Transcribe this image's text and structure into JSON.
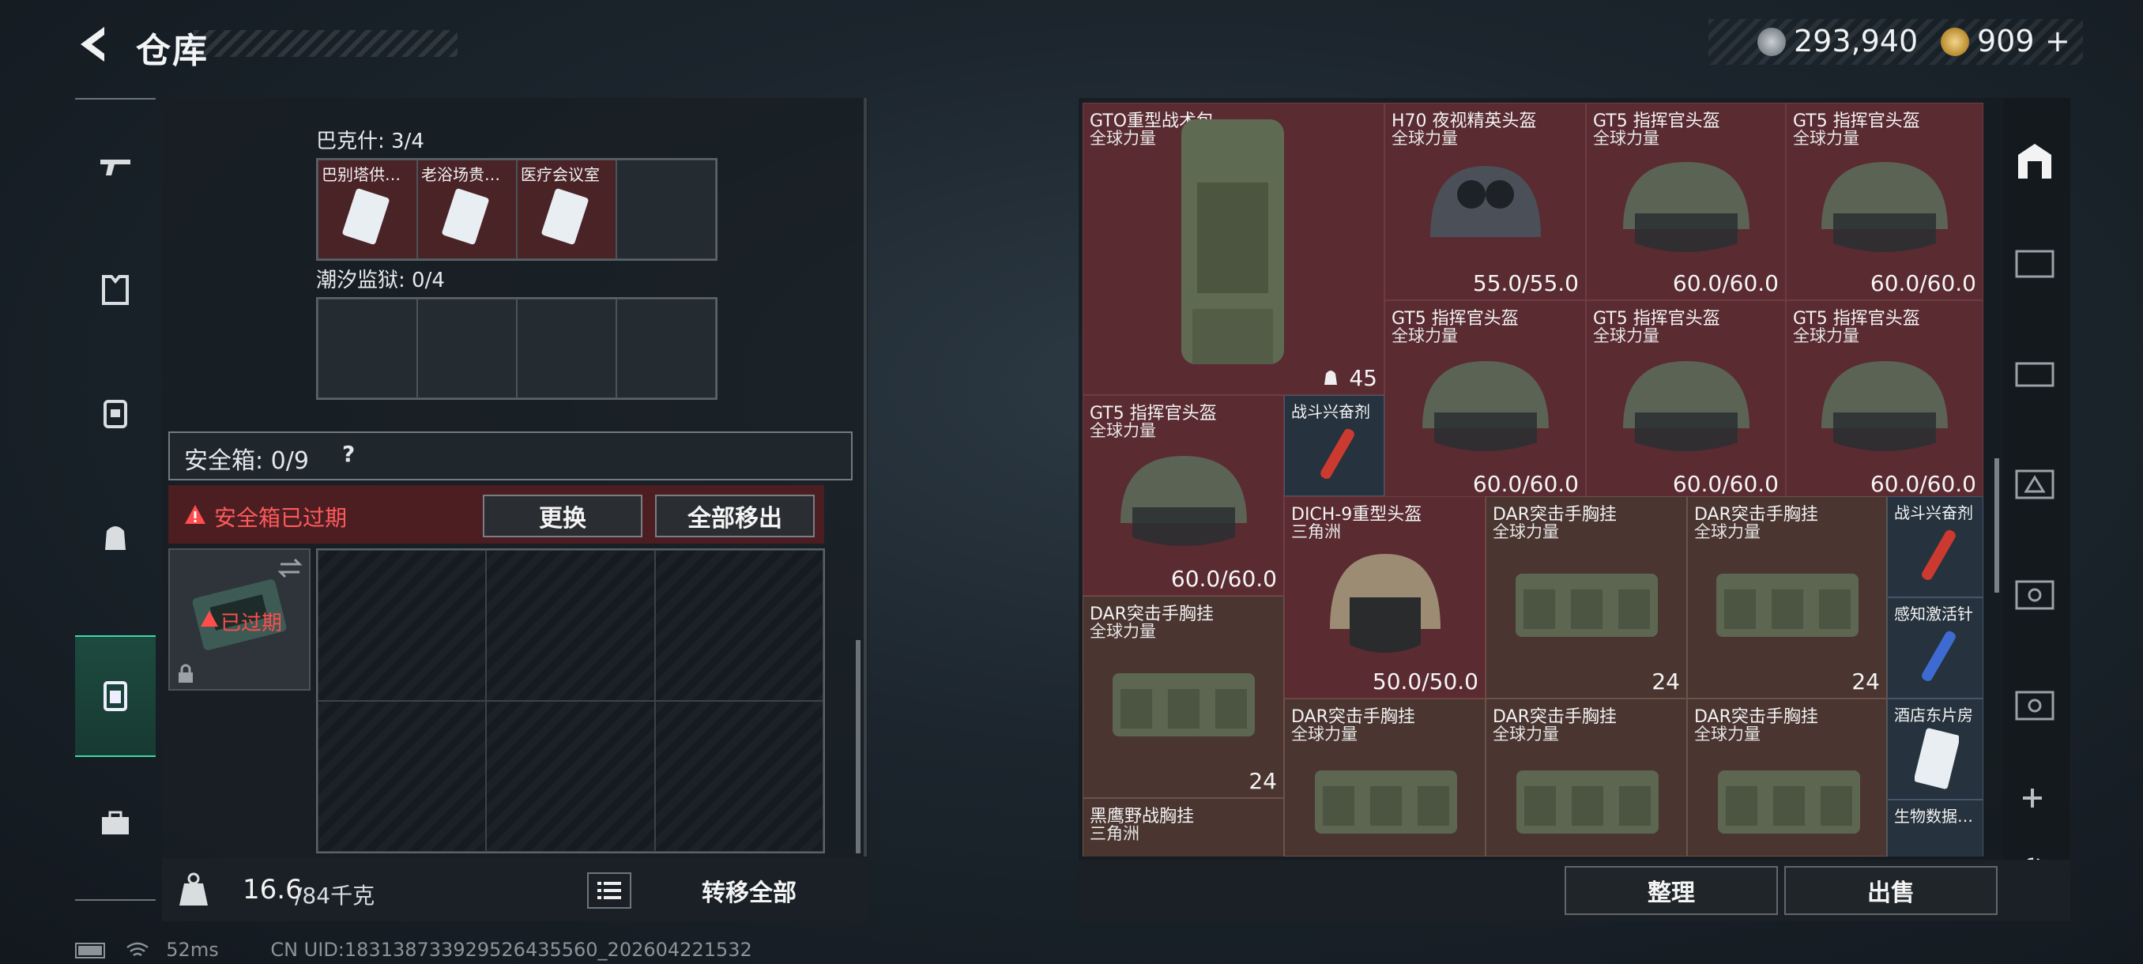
{
  "header": {
    "title": "仓库",
    "currency_1": "293,940",
    "currency_2": "909",
    "plus": "+"
  },
  "left_nav": [
    "weapon-icon",
    "armor-icon",
    "backpack-icon",
    "bag-icon",
    "safebox-icon",
    "case-icon"
  ],
  "left_panel": {
    "group_1_label": "巴克什: 3/4",
    "group_1_items": [
      "巴别塔供…",
      "老浴场贵…",
      "医疗会议室"
    ],
    "group_2_label": "潮汐监狱: 0/4",
    "safebox_label": "安全箱: 0/9",
    "safebox_help": "?",
    "expired_warning": "安全箱已过期",
    "replace_button": "更换",
    "remove_all_button": "全部移出",
    "expired_tag": "已过期",
    "weight_current": "16.6",
    "weight_max": "/84千克",
    "transfer_all_button": "转移全部"
  },
  "right_grid": {
    "items": [
      {
        "name": "GTO重型战术包",
        "sub": "全球力量",
        "count": "45"
      },
      {
        "name": "H70 夜视精英头盔",
        "sub": "全球力量",
        "value": "55.0/55.0"
      },
      {
        "name": "GT5 指挥官头盔",
        "sub": "全球力量",
        "value": "60.0/60.0"
      },
      {
        "name": "GT5 指挥官头盔",
        "sub": "全球力量",
        "value": "60.0/60.0"
      },
      {
        "name": "GT5 指挥官头盔",
        "sub": "全球力量",
        "value": "60.0/60.0"
      },
      {
        "name": "GT5 指挥官头盔",
        "sub": "全球力量",
        "value": "60.0/60.0"
      },
      {
        "name": "GT5 指挥官头盔",
        "sub": "全球力量",
        "value": "60.0/60.0"
      },
      {
        "name": "GT5 指挥官头盔",
        "sub": "全球力量",
        "value": "60.0/60.0"
      },
      {
        "name": "战斗兴奋剂"
      },
      {
        "name": "DICH-9重型头盔",
        "sub": "三角洲",
        "value": "50.0/50.0"
      },
      {
        "name": "DAR突击手胸挂",
        "sub": "全球力量",
        "count": "24"
      },
      {
        "name": "DAR突击手胸挂",
        "sub": "全球力量",
        "count": "24"
      },
      {
        "name": "战斗兴奋剂"
      },
      {
        "name": "感知激活针"
      },
      {
        "name": "DAR突击手胸挂",
        "sub": "全球力量",
        "count": "24"
      },
      {
        "name": "DAR突击手胸挂",
        "sub": "全球力量"
      },
      {
        "name": "DAR突击手胸挂",
        "sub": "全球力量"
      },
      {
        "name": "DAR突击手胸挂",
        "sub": "全球力量"
      },
      {
        "name": "酒店东片房"
      },
      {
        "name": "黑鹰野战胸挂",
        "sub": "三角洲"
      },
      {
        "name": "生物数据…"
      }
    ],
    "sort_button": "整理",
    "sell_button": "出售"
  },
  "status_bar": {
    "ping": "52ms",
    "uid": "CN UID:183138733929526435560_202604221532"
  }
}
